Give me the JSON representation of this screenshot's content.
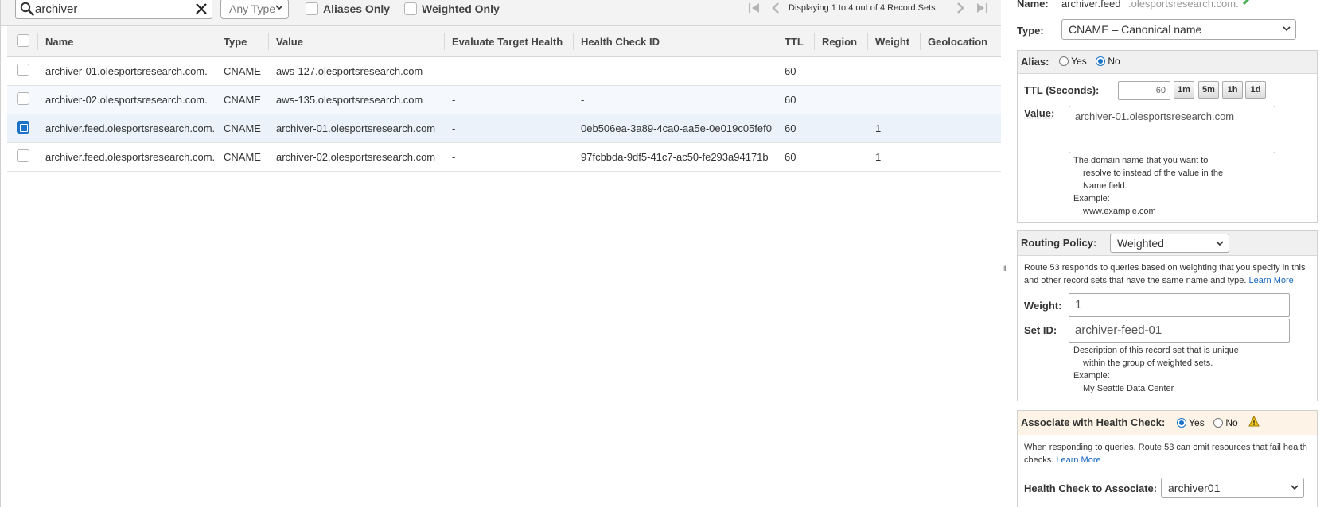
{
  "toolbar": {
    "search_value": "archiver",
    "type_filter": "Any Type",
    "aliases_only_label": "Aliases Only",
    "weighted_only_label": "Weighted Only",
    "pager_text": "Displaying 1 to 4 out of 4 Record Sets"
  },
  "table": {
    "columns": [
      "Name",
      "Type",
      "Value",
      "Evaluate Target Health",
      "Health Check ID",
      "TTL",
      "Region",
      "Weight",
      "Geolocation"
    ],
    "rows": [
      {
        "name": "archiver-01.olesportsresearch.com.",
        "type": "CNAME",
        "value": "aws-127.olesportsresearch.com",
        "eval": "-",
        "hcid": "-",
        "ttl": "60",
        "region": "",
        "weight": "",
        "geo": "",
        "selected": false
      },
      {
        "name": "archiver-02.olesportsresearch.com.",
        "type": "CNAME",
        "value": "aws-135.olesportsresearch.com",
        "eval": "-",
        "hcid": "-",
        "ttl": "60",
        "region": "",
        "weight": "",
        "geo": "",
        "selected": false
      },
      {
        "name": "archiver.feed.olesportsresearch.com.",
        "type": "CNAME",
        "value": "archiver-01.olesportsresearch.com",
        "eval": "-",
        "hcid": "0eb506ea-3a89-4ca0-aa5e-0e019c05fef0",
        "ttl": "60",
        "region": "",
        "weight": "1",
        "geo": "",
        "selected": true
      },
      {
        "name": "archiver.feed.olesportsresearch.com.",
        "type": "CNAME",
        "value": "archiver-02.olesportsresearch.com",
        "eval": "-",
        "hcid": "97fcbbda-9df5-41c7-ac50-fe293a94171b",
        "ttl": "60",
        "region": "",
        "weight": "1",
        "geo": "",
        "selected": false
      }
    ]
  },
  "editor": {
    "name_label": "Name:",
    "name_value": "archiver.feed",
    "name_suffix": ".olesportsresearch.com.",
    "type_label": "Type:",
    "type_value": "CNAME – Canonical name",
    "alias_label": "Alias:",
    "alias_yes": "Yes",
    "alias_no": "No",
    "ttl_label": "TTL (Seconds):",
    "ttl_value": "60",
    "ttl_buttons": [
      "1m",
      "5m",
      "1h",
      "1d"
    ],
    "value_label": "Value:",
    "value_text": "archiver-01.olesportsresearch.com",
    "value_help": [
      "The domain name that you want to",
      "resolve to instead of the value in the",
      "Name field.",
      "Example:",
      "www.example.com"
    ],
    "routing_label": "Routing Policy:",
    "routing_value": "Weighted",
    "routing_desc": "Route 53 responds to queries based on weighting that you specify in this and other record sets that have the same name and type.",
    "learn_more": "Learn More",
    "weight_label": "Weight:",
    "weight_value": "1",
    "setid_label": "Set ID:",
    "setid_value": "archiver-feed-01",
    "setid_help": [
      "Description of this record set that is unique",
      "within the group of weighted sets.",
      "Example:",
      "My Seattle Data Center"
    ],
    "health_label": "Associate with Health Check:",
    "health_yes": "Yes",
    "health_no": "No",
    "health_desc": "When responding to queries, Route 53 can omit resources that fail health checks.",
    "hc_assoc_label": "Health Check to Associate:",
    "hc_assoc_value": "archiver01"
  }
}
